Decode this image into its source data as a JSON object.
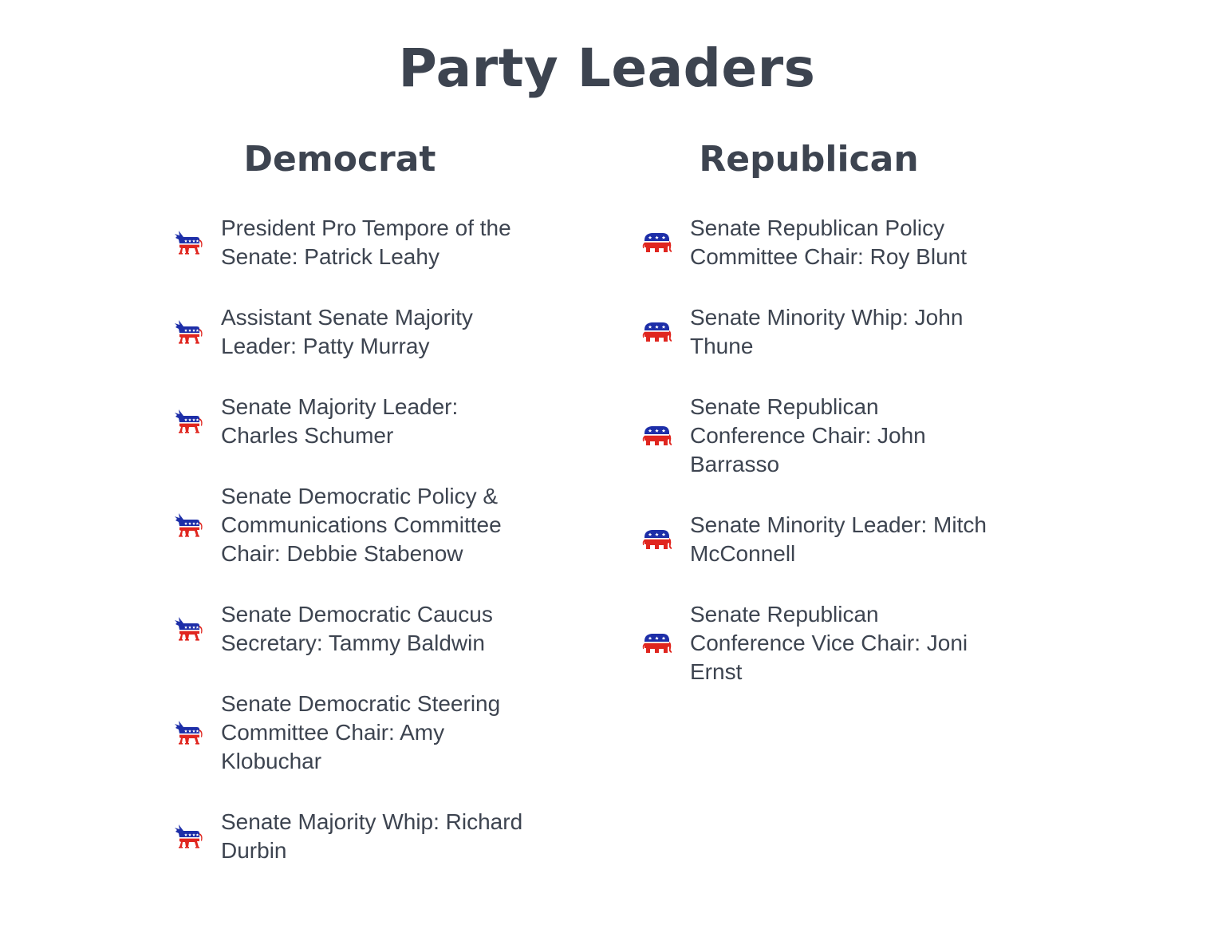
{
  "title": "Party Leaders",
  "colors": {
    "text": "#3d4450",
    "blue": "#1d2ea8",
    "red": "#e0261f"
  },
  "democrat": {
    "heading": "Democrat",
    "icon": "democrat-donkey-icon",
    "leaders": [
      "President Pro Tempore of the Senate: Patrick Leahy",
      "Assistant Senate Majority Leader: Patty Murray",
      "Senate Majority Leader: Charles Schumer",
      "Senate Democratic Policy & Communications Committee Chair: Debbie Stabenow",
      "Senate Democratic Caucus Secretary: Tammy Baldwin",
      "Senate Democratic Steering Committee Chair: Amy Klobuchar",
      "Senate Majority Whip: Richard Durbin"
    ]
  },
  "republican": {
    "heading": "Republican",
    "icon": "republican-elephant-icon",
    "leaders": [
      "Senate Republican Policy Committee Chair: Roy Blunt",
      "Senate Minority Whip: John Thune",
      "Senate Republican Conference Chair: John Barrasso",
      "Senate Minority Leader: Mitch McConnell",
      "Senate Republican Conference Vice Chair: Joni Ernst"
    ]
  }
}
